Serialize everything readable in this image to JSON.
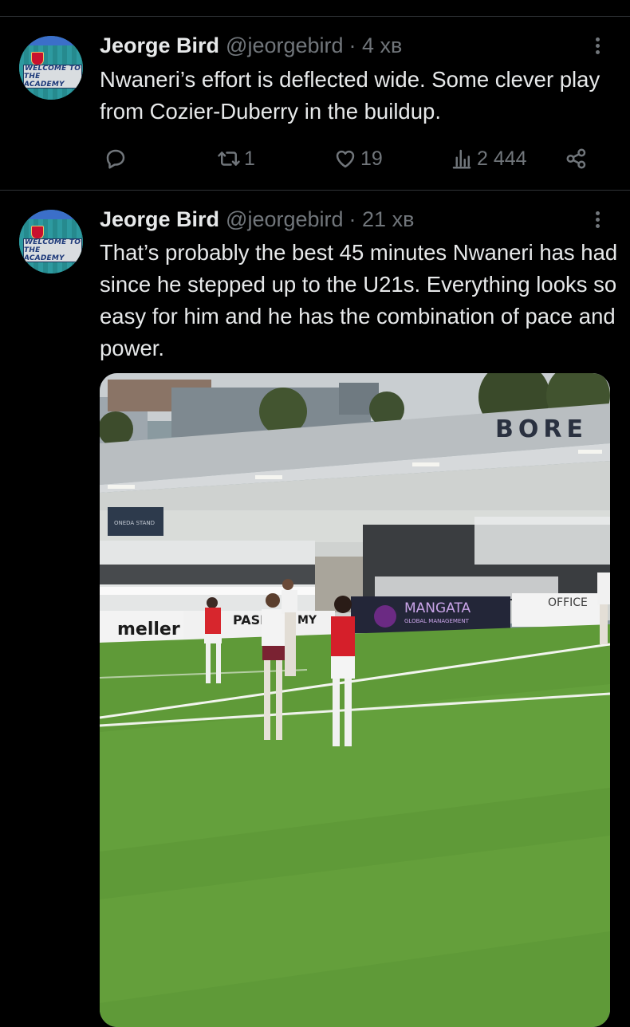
{
  "tweets": [
    {
      "author_name": "Jeorge Bird",
      "handle": "@jeorgebird",
      "time": "· 4 хв",
      "text": "Nwaneri’s effort is deflected wide. Some clever play from Cozier-Duberry in the buildup.",
      "avatar_sign": [
        "WELCOME TO",
        "THE ACADEMY"
      ],
      "reply_count": "",
      "retweet_count": "1",
      "like_count": "19",
      "view_count": "2 444",
      "icons": [
        "reply-icon",
        "retweet-icon",
        "like-icon",
        "views-icon",
        "share-icon"
      ]
    },
    {
      "author_name": "Jeorge Bird",
      "handle": "@jeorgebird",
      "time": "· 21 хв",
      "text": "That’s probably the best 45 minutes Nwaneri has had since he stepped up to the U21s. Everything looks so easy for him and he has the combination of pace and power.",
      "avatar_sign": [
        "WELCOME TO",
        "THE ACADEMY"
      ],
      "photo": {
        "stand_sign": "BORE",
        "stand_label": "ONEDA STAND",
        "boards": [
          "meller",
          "PASE",
          "MY",
          "MANGATA",
          "GLOBAL MANAGEMENT",
          "OFFICE"
        ]
      }
    }
  ],
  "colors": {
    "background": "#000000",
    "text": "#e7e9ea",
    "muted": "#71767b",
    "divider": "#2f3336"
  }
}
